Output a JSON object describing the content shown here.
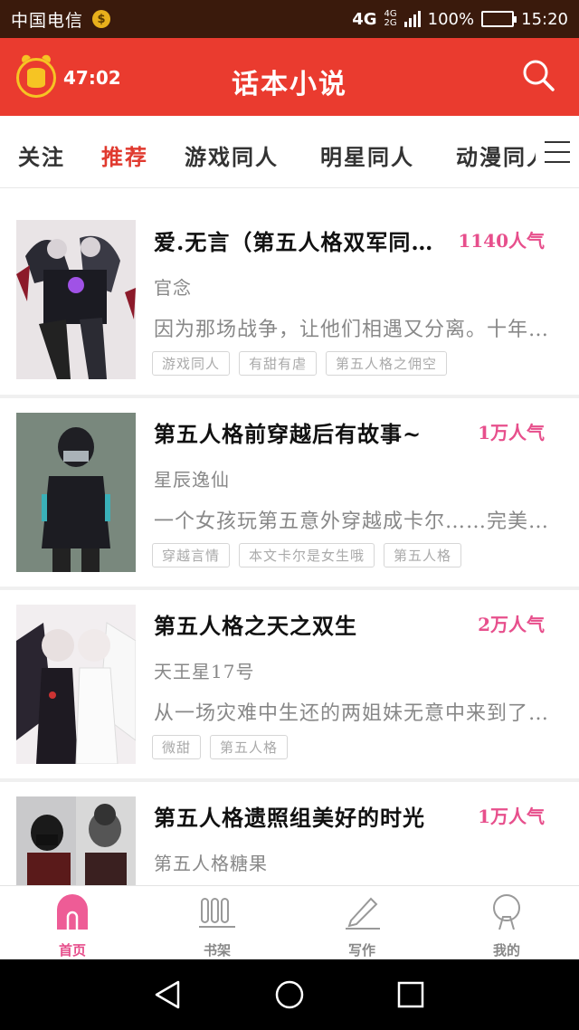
{
  "status_bar": {
    "carrier": "中国电信",
    "coin_glyph": "$",
    "network": "4G",
    "network_small_top": "4G",
    "network_small_bottom": "2G",
    "battery": "100%",
    "battery_level": 1.0,
    "time": "15:20"
  },
  "appbar": {
    "timer": "47:02",
    "title": "话本小说",
    "accent": "#ea3b2f"
  },
  "tabs": [
    {
      "label": "关注",
      "active": false
    },
    {
      "label": "推荐",
      "active": true
    },
    {
      "label": "游戏同人",
      "active": false
    },
    {
      "label": "明星同人",
      "active": false
    },
    {
      "label": "动漫同人",
      "active": false
    }
  ],
  "books": [
    {
      "title": "爱.无言（第五人格双军同人）",
      "popularity": "1140人气",
      "author": "官念",
      "description": "因为那场战争，让他们相遇又分离。十年后……",
      "tags": [
        "游戏同人",
        "有甜有虐",
        "第五人格之佣空"
      ]
    },
    {
      "title": "第五人格前穿越后有故事~",
      "popularity": "1万人气",
      "author": "星辰逸仙",
      "description": "一个女孩玩第五意外穿越成卡尔……完美……",
      "tags": [
        "穿越言情",
        "本文卡尔是女生哦",
        "第五人格"
      ]
    },
    {
      "title": "第五人格之天之双生",
      "popularity": "2万人气",
      "author": "天王星17号",
      "description": "从一场灾难中生还的两姐妹无意中来到了……",
      "tags": [
        "微甜",
        "第五人格"
      ]
    },
    {
      "title": "第五人格遗照组美好的时光",
      "popularity": "1万人气",
      "author": "第五人格糖果",
      "description": "",
      "tags": []
    }
  ],
  "bottom_nav": [
    {
      "label": "首页",
      "icon": "home-icon",
      "active": true
    },
    {
      "label": "书架",
      "icon": "bookshelf-icon",
      "active": false
    },
    {
      "label": "写作",
      "icon": "pencil-icon",
      "active": false
    },
    {
      "label": "我的",
      "icon": "profile-icon",
      "active": false
    }
  ],
  "colors": {
    "accent_red": "#ea3b2f",
    "popularity_pink": "#e74f8c",
    "timer_gold": "#f6c423"
  }
}
